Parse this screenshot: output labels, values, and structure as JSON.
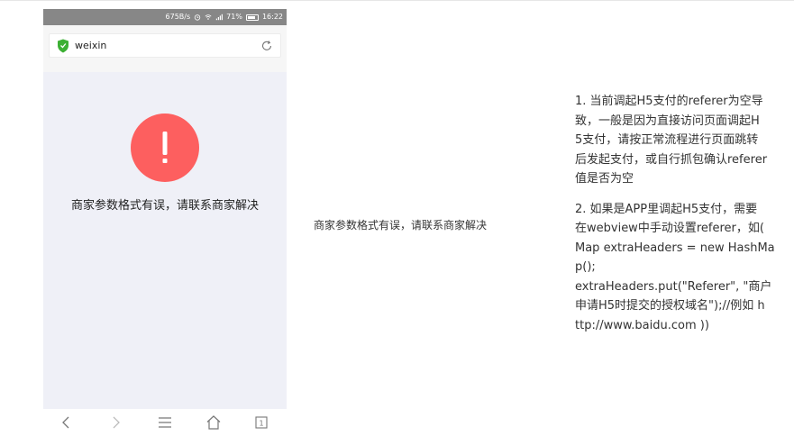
{
  "statusbar": {
    "network_speed": "675B/s",
    "battery_percent": "71%",
    "time": "16:22"
  },
  "browser": {
    "url_text": "weixin"
  },
  "error": {
    "icon_text": "!",
    "message": "商家参数格式有误，请联系商家解决"
  },
  "middle_caption": "商家参数格式有误，请联系商家解决",
  "notes": {
    "note1": [
      "1. 当前调起H5支付的referer为空导",
      "致，一般是因为直接访问页面调起H",
      "5支付，请按正常流程进行页面跳转",
      "后发起支付，或自行抓包确认referer",
      "值是否为空"
    ],
    "note2": [
      "2. 如果是APP里调起H5支付，需要",
      "在webview中手动设置referer，如(",
      "Map extraHeaders = new HashMa",
      "p();",
      "extraHeaders.put(\"Referer\", \"商户",
      "申请H5时提交的授权域名\");//例如 h",
      "ttp://www.baidu.com ))"
    ]
  },
  "colors": {
    "error_red": "#fd5f5f",
    "statusbar_gray": "#878787",
    "page_bg": "#eff0f7",
    "shield_green": "#3cb034"
  },
  "navbar": {
    "tabs_count": "1"
  }
}
